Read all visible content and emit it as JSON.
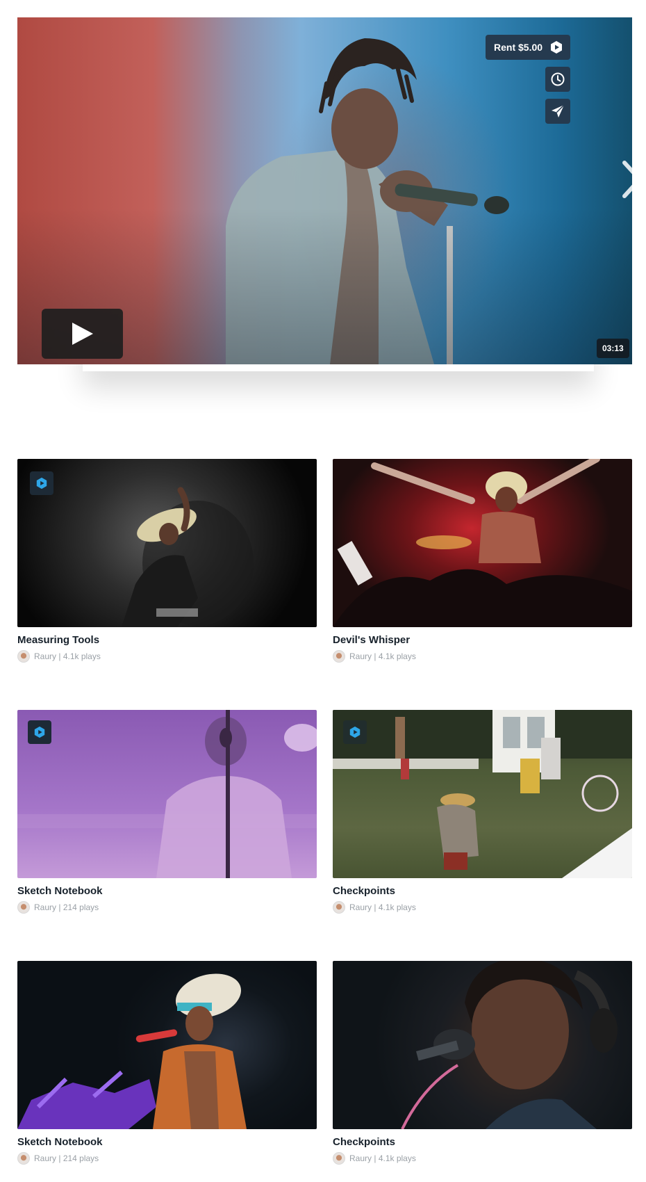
{
  "hero": {
    "rent_label": "Rent $5.00",
    "duration": "03:13",
    "icons": {
      "rent": "play-hexagon-icon",
      "watch_later": "clock-icon",
      "share": "send-icon",
      "play": "play-icon",
      "next": "chevron-right-icon"
    }
  },
  "videos": [
    {
      "title": "Measuring Tools",
      "artist": "Raury",
      "plays": "4.1k plays",
      "badge": true
    },
    {
      "title": "Devil's Whisper",
      "artist": "Raury",
      "plays": "4.1k plays",
      "badge": false
    },
    {
      "title": "Sketch Notebook",
      "artist": "Raury",
      "plays": "214 plays",
      "badge": true
    },
    {
      "title": "Checkpoints",
      "artist": "Raury",
      "plays": "4.1k plays",
      "badge": true
    },
    {
      "title": "Sketch Notebook",
      "artist": "Raury",
      "plays": "214 plays",
      "badge": false
    },
    {
      "title": "Checkpoints",
      "artist": "Raury",
      "plays": "4.1k plays",
      "badge": false
    }
  ],
  "separator": " | ",
  "colors": {
    "button_bg": "#253a4f",
    "badge_accent": "#2ea6e8",
    "title_text": "#17212b",
    "meta_text": "#9aa0a6"
  }
}
